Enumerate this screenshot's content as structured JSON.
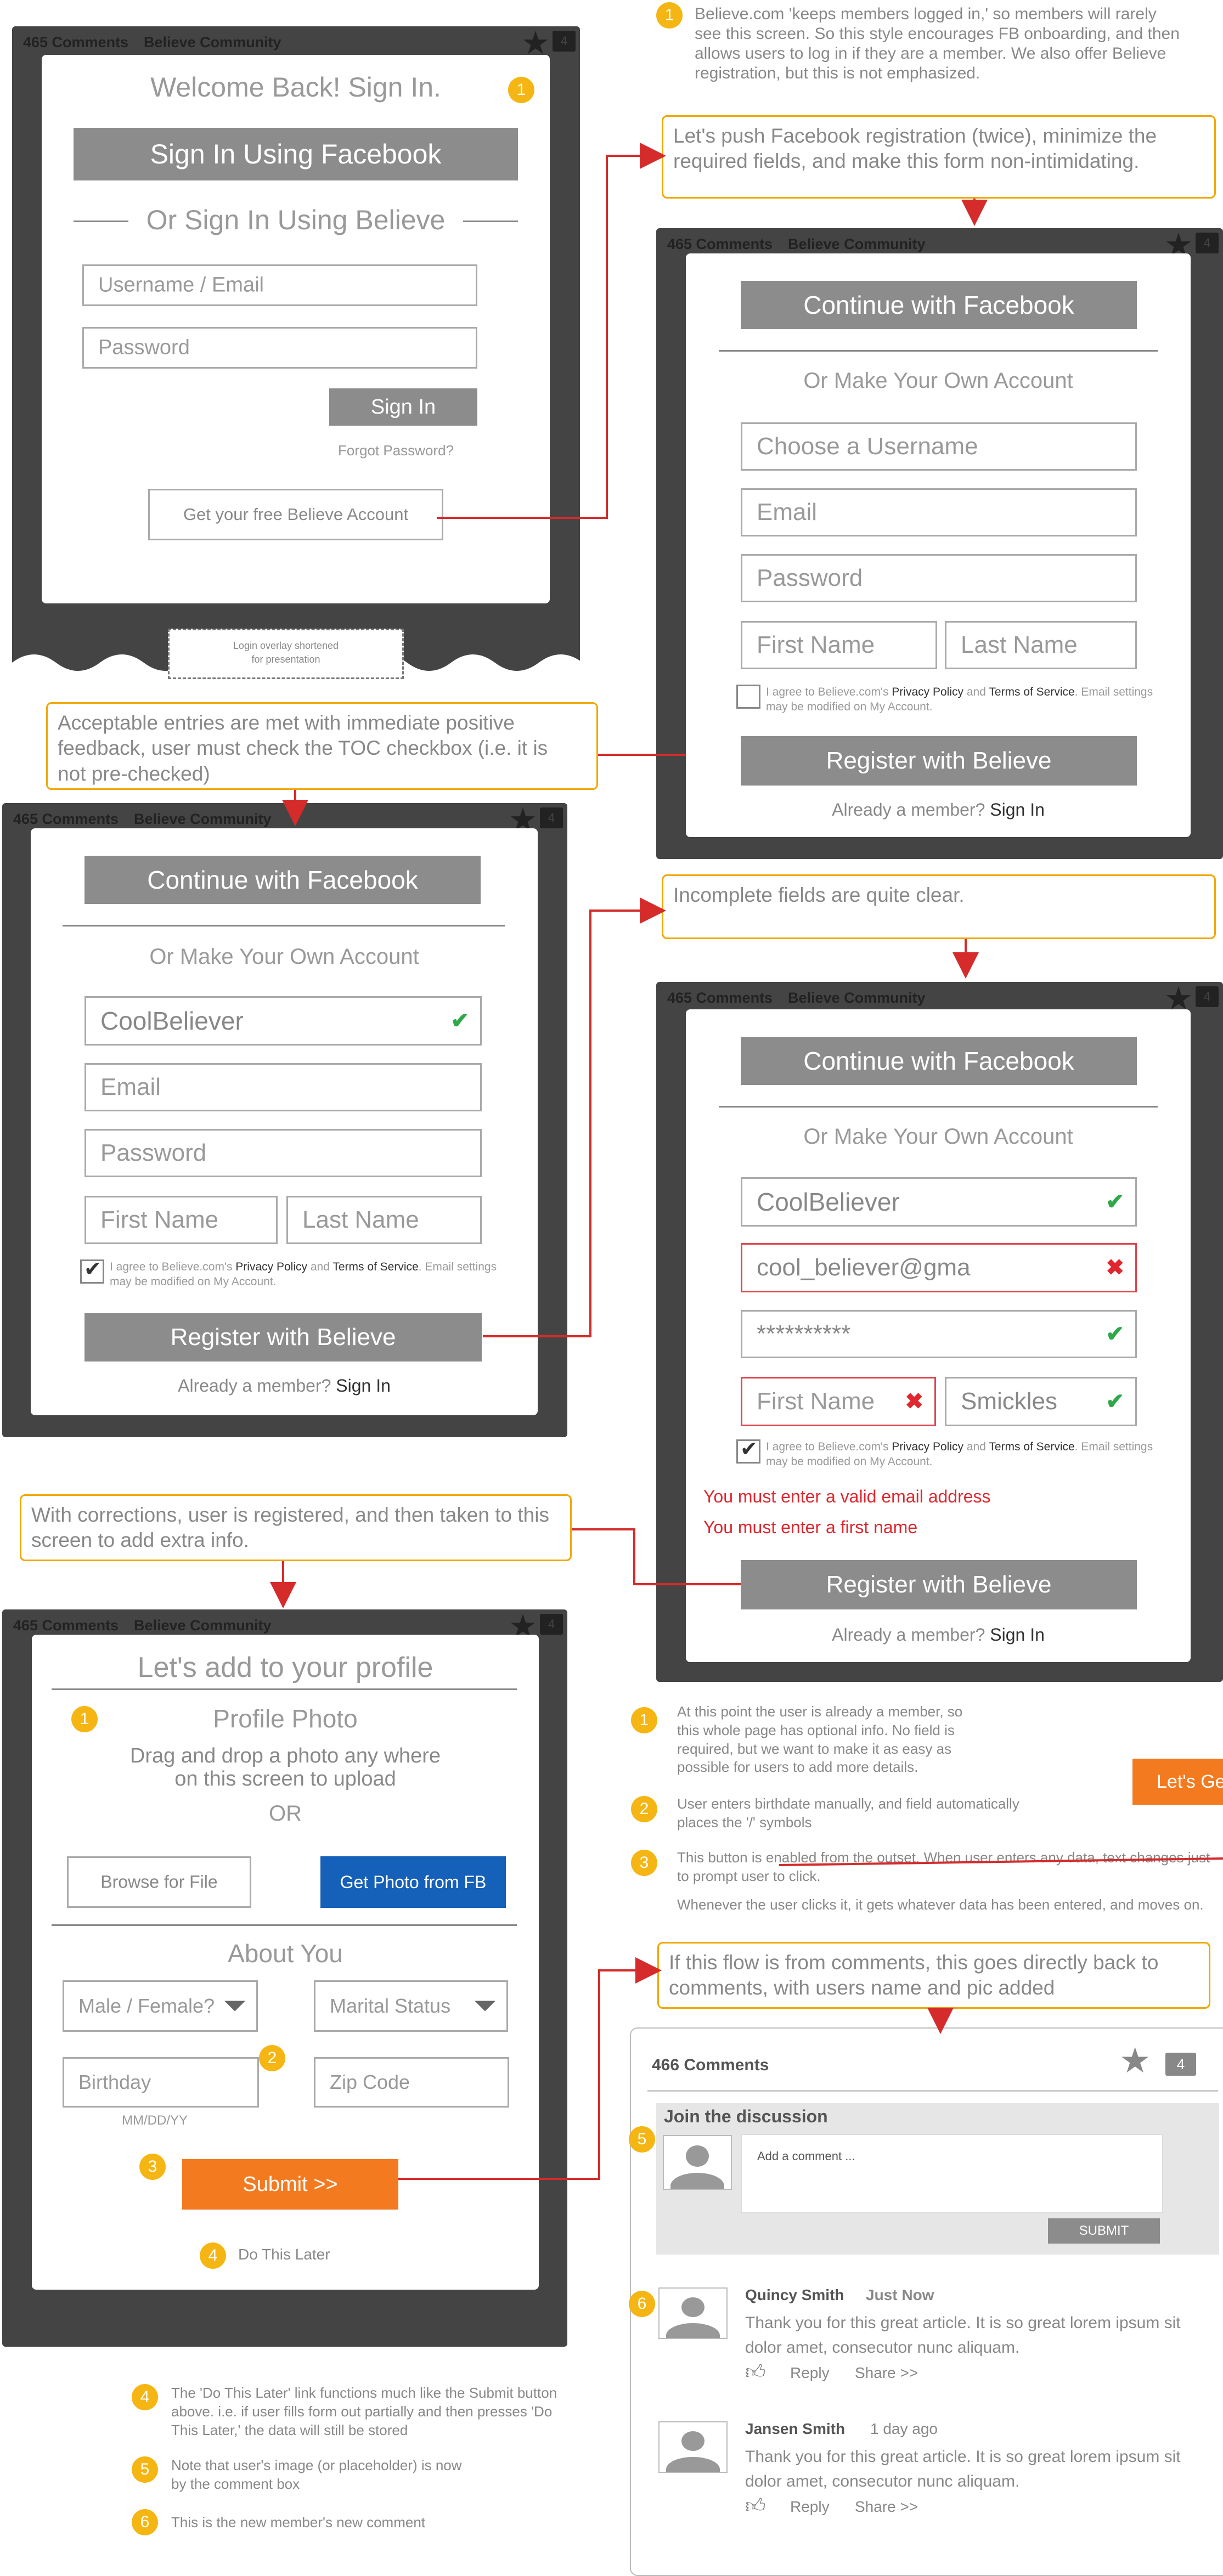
{
  "frame": {
    "comments": "465 Comments",
    "community": "Believe Community",
    "badge": "4"
  },
  "screen1": {
    "title": "Welcome Back! Sign In.",
    "facebook_button": "Sign In Using Facebook",
    "divider": "Or Sign In Using Believe",
    "username_placeholder": "Username / Email",
    "password_placeholder": "Password",
    "signin_button": "Sign In",
    "forgot": "Forgot Password?",
    "free_account_button": "Get your free Believe Account",
    "shortened_line1": "Login overlay shortened",
    "shortened_line2": "for presentation"
  },
  "register": {
    "facebook_button": "Continue with Facebook",
    "divider": "Or Make Your Own Account",
    "username_placeholder": "Choose a Username",
    "email_placeholder": "Email",
    "password_placeholder": "Password",
    "first_placeholder": "First Name",
    "last_placeholder": "Last Name",
    "terms_1": "I agree to Believe.com's ",
    "privacy": "Privacy Policy",
    "terms_and": " and ",
    "tos": "Terms of Service",
    "terms_2": ". Email settings may be modified on My Account.",
    "register_button": "Register with Believe",
    "already": "Already a member? ",
    "signin_link": "Sign In"
  },
  "screen3": {
    "username_value": "CoolBeliever",
    "email_placeholder": "Email",
    "password_placeholder": "Password",
    "first_placeholder": "First Name",
    "last_placeholder": "Last Name"
  },
  "screen4": {
    "username_value": "CoolBeliever",
    "email_value": "cool_believer@gma",
    "password_value": "**********",
    "first_placeholder": "First Name",
    "last_value": "Smickles",
    "error_email": "You must enter a valid email address",
    "error_first": "You must enter a first name"
  },
  "profile": {
    "title": "Let's add to your profile",
    "photo_heading": "Profile Photo",
    "drag_line1": "Drag and drop a photo any where",
    "drag_line2": "on this screen to upload",
    "or": "OR",
    "browse_button": "Browse for File",
    "fb_photo_button": "Get Photo from FB",
    "about_heading": "About You",
    "gender": "Male / Female?",
    "marital": "Marital Status",
    "birthday_placeholder": "Birthday",
    "date_format": "MM/DD/YY",
    "zip_placeholder": "Zip Code",
    "submit_button": "Submit >>",
    "later_link": "Do This Later"
  },
  "comments_panel": {
    "count": "466 Comments",
    "badge": "4",
    "join": "Join the discussion",
    "comment_placeholder": "Add a comment ...",
    "submit": "SUBMIT",
    "items": [
      {
        "author": "Quincy Smith",
        "time": "Just Now",
        "text_1": "Thank you for this great article. It is so great lorem ipsum sit",
        "text_2": "dolor amet, consecutor nunc aliquam.",
        "reply": "Reply",
        "share": "Share >>"
      },
      {
        "author": "Jansen Smith",
        "time": "1 day ago",
        "text_1": "Thank you for this great article. It is so great lorem ipsum sit",
        "text_2": "dolor amet, consecutor nunc aliquam.",
        "reply": "Reply",
        "share": "Share >>"
      }
    ]
  },
  "cut_off_button": "Let's Ge",
  "notes": {
    "n1_num": "1",
    "n1_line1": "Believe.com 'keeps members logged in,' so members will rarely",
    "n1_line2": "see this screen. So this style encourages FB onboarding, and then",
    "n1_line3": "allows users to log in if they are a member. We also offer Believe",
    "n1_line4": "registration, but this is not emphasized.",
    "box1_line1": "Let's push Facebook registration (twice), minimize the",
    "box1_line2": "required fields, and make this form non-intimidating.",
    "box2_line1": "Acceptable entries are met with immediate positive",
    "box2_line2": "feedback, user must check the TOC checkbox  (i.e. it is",
    "box2_line3": "not pre-checked)",
    "box3": "Incomplete fields are quite clear.",
    "box4_line1": "With corrections, user is registered, and then taken to this",
    "box4_line2": "screen to add extra info.",
    "box5_line1": "If this flow is from comments, this goes directly back to",
    "box5_line2": "comments, with users name and pic added",
    "s1_num": "1",
    "s1_line1": "At this point the user is already a member, so",
    "s1_line2": "this whole page has optional info. No field is",
    "s1_line3": "required, but we want to make it as easy as",
    "s1_line4": "possible for users to add more details.",
    "s2_num": "2",
    "s2_line1": "User enters birthdate manually, and field  automatically",
    "s2_line2": "places the '/' symbols",
    "s3_num": "3",
    "s3_line1": "This button is enabled from the outset. When user enters any data, text changes just",
    "s3_line2": "to prompt user to click.",
    "s3_line3": "Whenever the user clicks it, it gets whatever data has been entered, and moves on.",
    "s4_num": "4",
    "s4_line1": "The 'Do This Later' link functions much like the Submit button",
    "s4_line2": "above. i.e. if user fills form out partially and then presses 'Do",
    "s4_line3": "This Later,' the data will still be stored",
    "s5_num": "5",
    "s5_line1": "Note that user's image (or placeholder) is now",
    "s5_line2": "by the comment box",
    "s6_num": "6",
    "s6_line1": "This is the new member's new comment"
  },
  "colors": {
    "accent_red": "#e0262e",
    "note_border": "#f0a800",
    "number_badge": "#f5b512",
    "submit_orange": "#f47a20",
    "facebook_blue": "#1560b8",
    "ok_green": "#2fa84a"
  }
}
